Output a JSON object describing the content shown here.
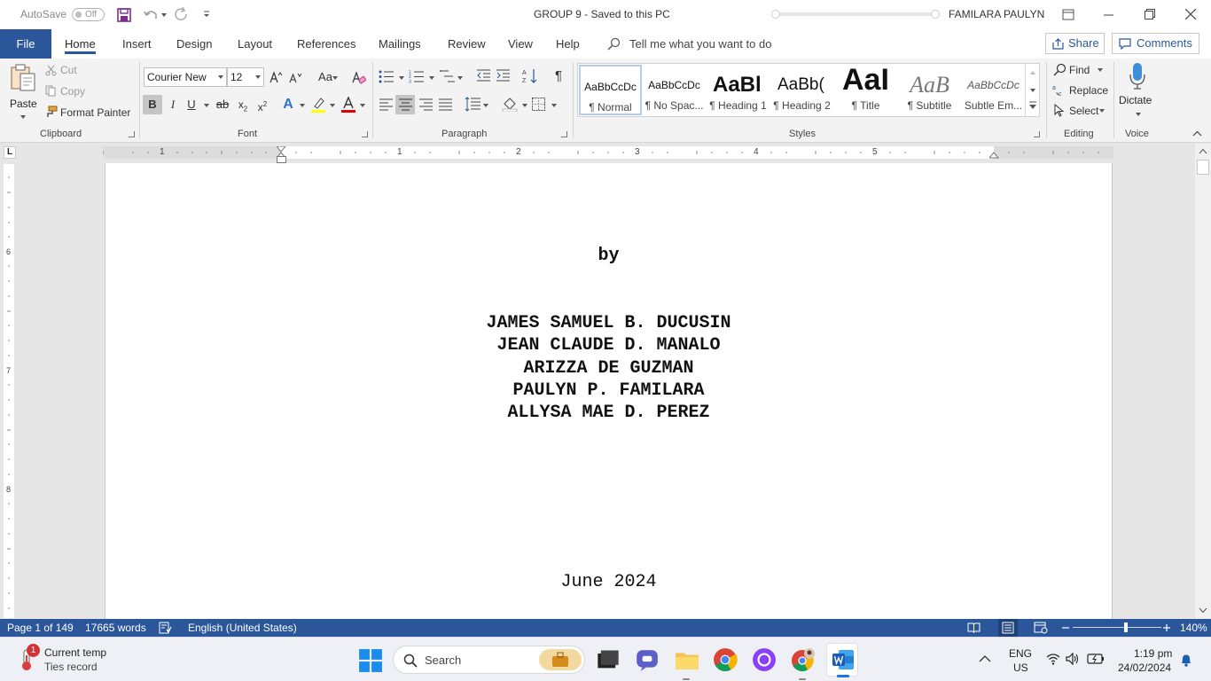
{
  "titlebar": {
    "autosave_label": "AutoSave",
    "autosave_state": "Off",
    "doc_title": "GROUP 9  -  Saved to this PC",
    "user_name": "FAMILARA PAULYN"
  },
  "tabs": {
    "file": "File",
    "items": [
      "Home",
      "Insert",
      "Design",
      "Layout",
      "References",
      "Mailings",
      "Review",
      "View",
      "Help"
    ],
    "active": "Home",
    "tell_me": "Tell me what you want to do",
    "share": "Share",
    "comments": "Comments"
  },
  "clipboard": {
    "paste": "Paste",
    "cut": "Cut",
    "copy": "Copy",
    "format_painter": "Format Painter",
    "label": "Clipboard"
  },
  "font": {
    "name": "Courier New",
    "size": "12",
    "change_case": "Aa",
    "label": "Font",
    "highlight_color": "#ffff00",
    "font_color": "#e00000"
  },
  "paragraph": {
    "label": "Paragraph"
  },
  "styles": {
    "items": [
      {
        "preview": "AaBbCcDc",
        "name": "¶ Normal"
      },
      {
        "preview": "AaBbCcDc",
        "name": "¶ No Spac..."
      },
      {
        "preview": "AaBl",
        "name": "¶ Heading 1"
      },
      {
        "preview": "AaBb(",
        "name": "¶ Heading 2"
      },
      {
        "preview": "AaI",
        "name": "¶ Title"
      },
      {
        "preview": "AaB",
        "name": "¶ Subtitle"
      },
      {
        "preview": "AaBbCcDc",
        "name": "Subtle Em..."
      }
    ],
    "selected": "¶ Normal",
    "label": "Styles"
  },
  "editing": {
    "find": "Find",
    "replace": "Replace",
    "select": "Select",
    "label": "Editing"
  },
  "voice": {
    "dictate": "Dictate",
    "label": "Voice"
  },
  "ruler": {
    "h_numbers": [
      "1",
      "1",
      "2",
      "3",
      "4",
      "5"
    ],
    "v_numbers": [
      "6",
      "7",
      "8"
    ]
  },
  "document": {
    "by": "by",
    "authors": [
      "JAMES SAMUEL B. DUCUSIN",
      "JEAN CLAUDE D. MANALO",
      "ARIZZA DE GUZMAN",
      "PAULYN P. FAMILARA",
      "ALLYSA MAE D. PEREZ"
    ],
    "date": "June 2024"
  },
  "status": {
    "page": "Page 1 of 149",
    "words": "17665 words",
    "language": "English (United States)",
    "zoom": "140%",
    "zoom_level": 0.6
  },
  "taskbar": {
    "weather_title": "Current temp",
    "weather_sub": "Ties record",
    "weather_badge": "1",
    "search": "Search",
    "lang_top": "ENG",
    "lang_bottom": "US",
    "time": "1:19 pm",
    "date": "24/02/2024"
  },
  "colors": {
    "accent": "#2b579a",
    "ribbon_bg": "#f3f3f3"
  }
}
